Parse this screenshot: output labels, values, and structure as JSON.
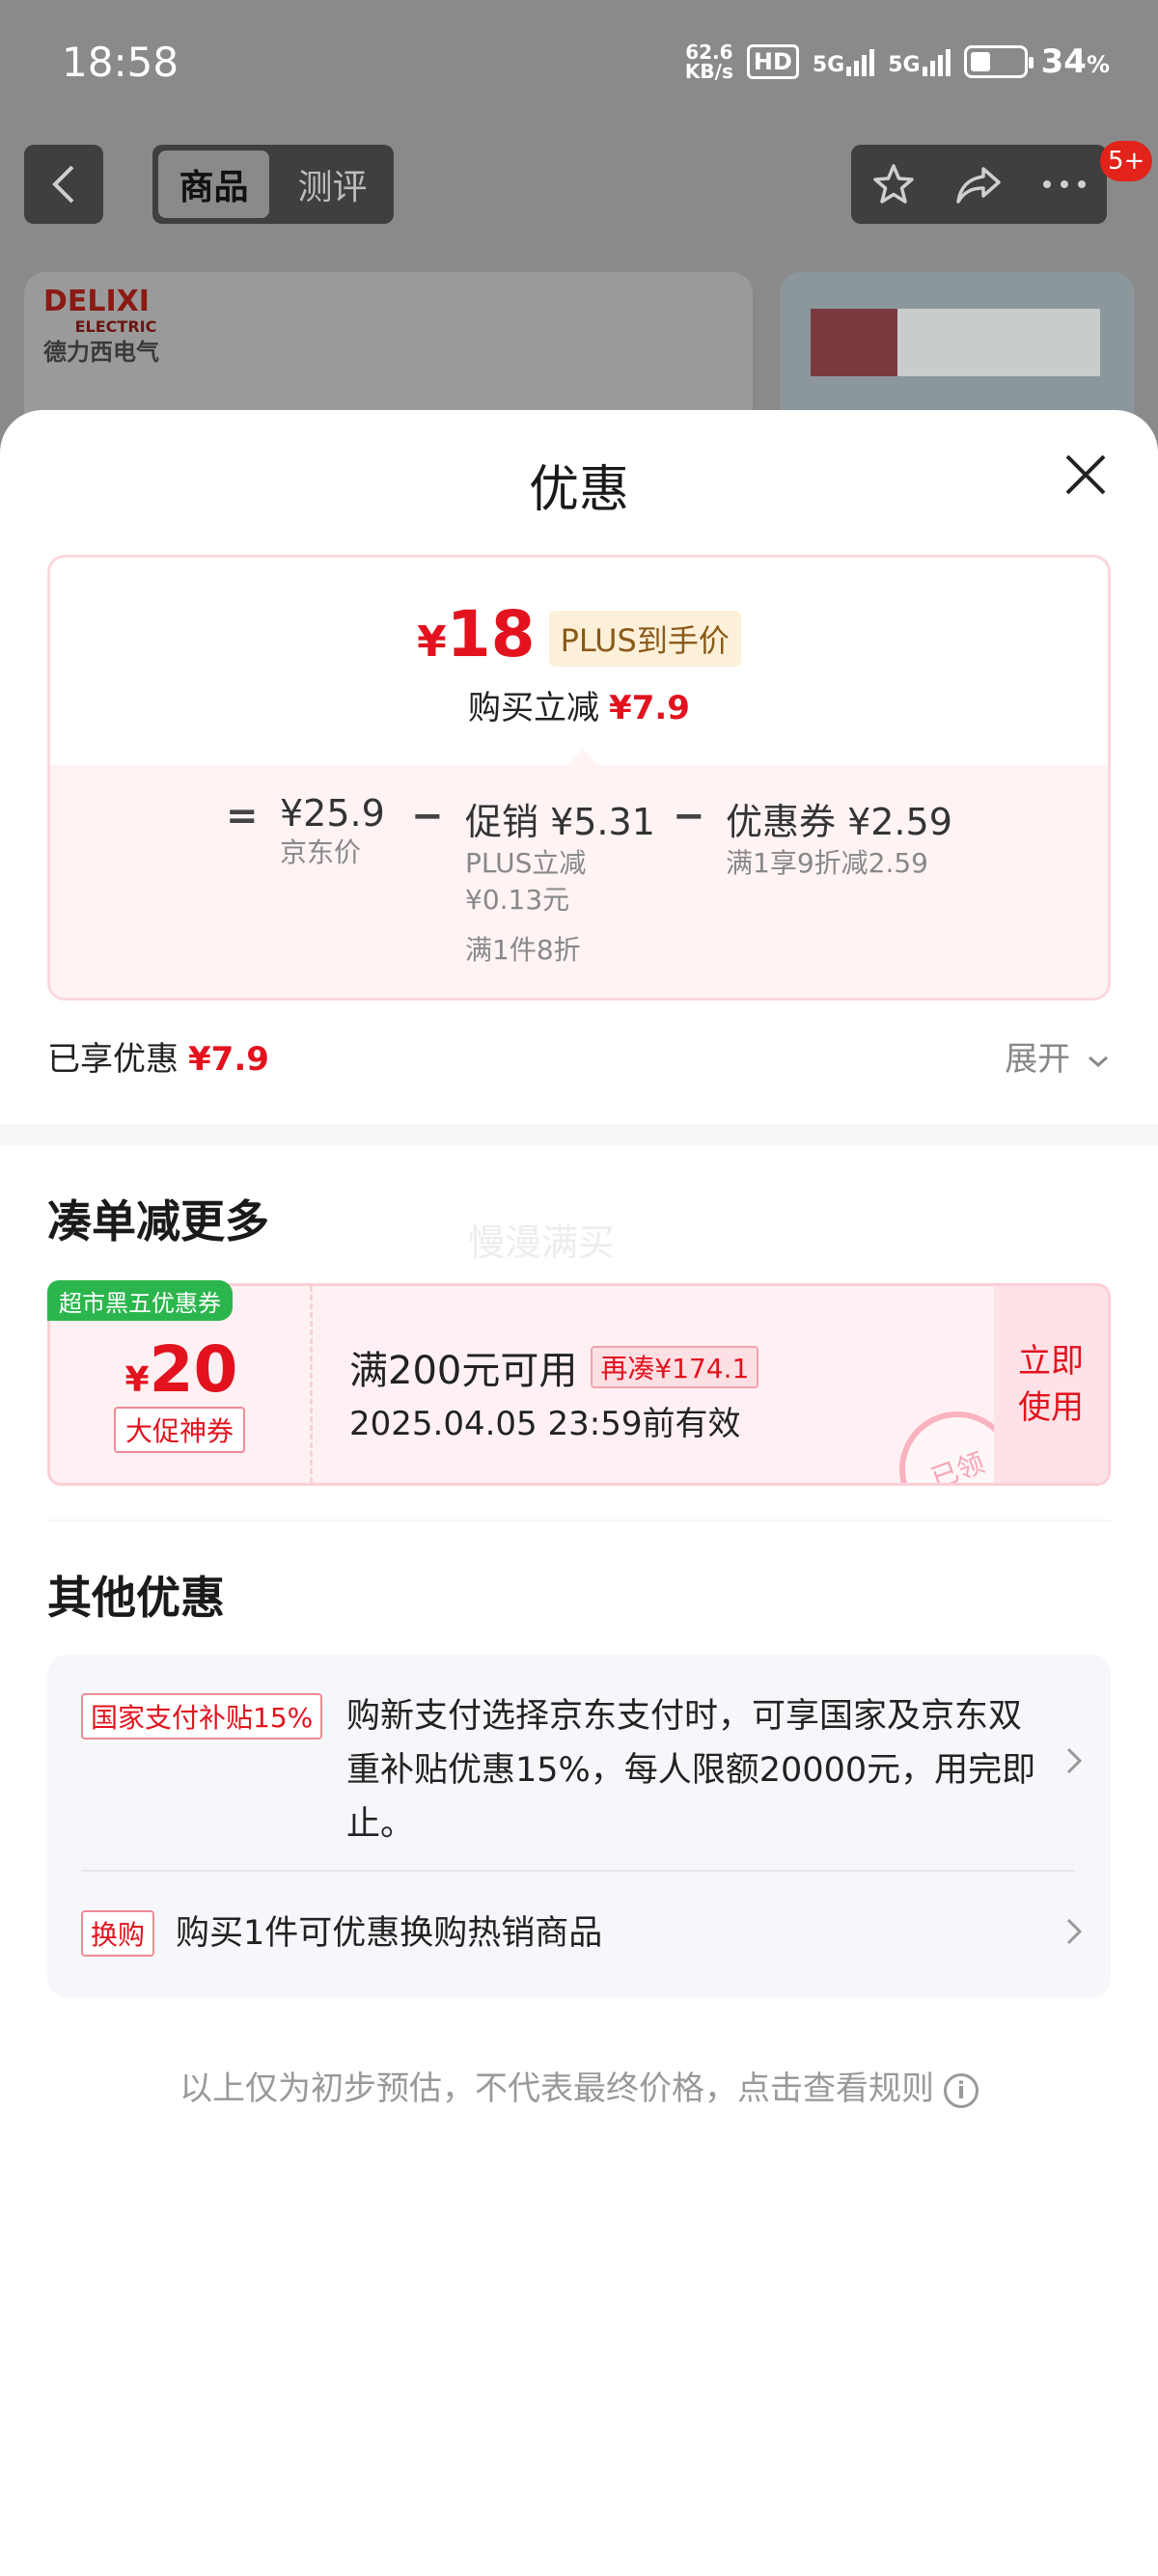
{
  "status_bar": {
    "time": "18:58",
    "net_speed_value": "62.6",
    "net_speed_unit": "KB/s",
    "hd_label": "HD",
    "signal1_label": "5G",
    "signal2_label": "5G",
    "battery_percent": "34",
    "battery_suffix": "%"
  },
  "top_nav": {
    "tabs": [
      {
        "label": "商品",
        "active": true
      },
      {
        "label": "测评",
        "active": false
      }
    ],
    "notification_badge": "5+"
  },
  "background_product": {
    "brand_en": "DELIXI",
    "brand_sub": "ELECTRIC",
    "brand_cn": "德力西电气"
  },
  "sheet": {
    "title": "优惠",
    "price_card": {
      "final_price_symbol": "¥",
      "final_price": "18",
      "plus_tag": "PLUS到手价",
      "instant_reduce_label": "购买立减",
      "instant_reduce_amount": "¥7.9",
      "calc": {
        "eq": "=",
        "minus": "−",
        "jd_price": "¥25.9",
        "jd_price_label": "京东价",
        "promo_amount": "促销 ¥5.31",
        "promo_detail_1": "PLUS立减",
        "promo_detail_2": "¥0.13元",
        "promo_detail_3": "满1件8折",
        "coupon_amount": "优惠券 ¥2.59",
        "coupon_detail": "满1享9折减2.59"
      }
    },
    "enjoyed_label": "已享优惠",
    "enjoyed_amount": "¥7.9",
    "expand_label": "展开",
    "section_more": {
      "title": "凑单减更多",
      "watermark": "慢漫满买",
      "coupon": {
        "tag": "超市黑五优惠券",
        "symbol": "¥",
        "amount": "20",
        "kind": "大促神券",
        "condition": "满200元可用",
        "extra": "再凑¥174.1",
        "expiry": "2025.04.05 23:59前有效",
        "use_label_1": "立即",
        "use_label_2": "使用",
        "stamp": "已领"
      }
    },
    "section_other": {
      "title": "其他优惠",
      "items": [
        {
          "tag": "国家支付补贴15%",
          "text": "购新支付选择京东支付时，可享国家及京东双重补贴优惠15%，每人限额20000元，用完即止。"
        },
        {
          "tag": "换购",
          "text": "购买1件可优惠换购热销商品"
        }
      ]
    },
    "disclaimer": "以上仅为初步预估，不代表最终价格，点击查看规则"
  },
  "colors": {
    "price_red": "#e2131e",
    "plus_gold_bg": "#fdf0d8",
    "coupon_tag_green": "#2bb64d",
    "card_pink_border": "#fbd7dc"
  },
  "icons": [
    "back-arrow-icon",
    "star-icon",
    "share-icon",
    "more-icon",
    "close-icon",
    "chevron-down-icon",
    "chevron-right-icon",
    "info-icon"
  ]
}
